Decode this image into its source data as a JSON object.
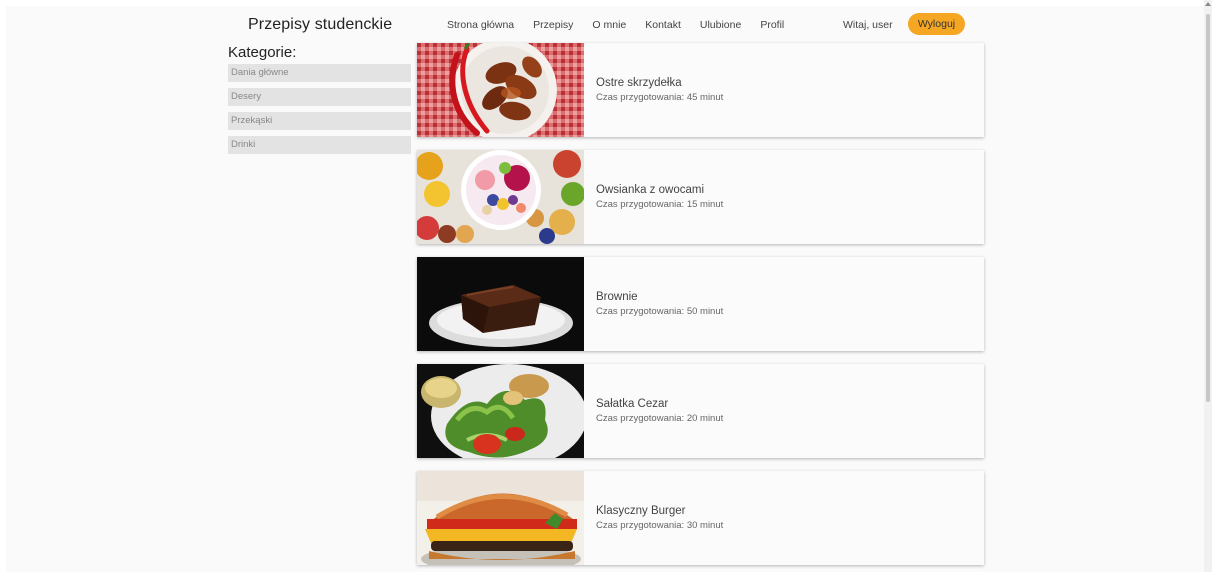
{
  "header": {
    "brand": "Przepisy studenckie",
    "nav": [
      "Strona główna",
      "Przepisy",
      "O mnie",
      "Kontakt",
      "Ulubione",
      "Profil"
    ],
    "greeting": "Witaj, user",
    "logout_label": "Wyloguj",
    "accent_color": "#f5a623"
  },
  "sidebar": {
    "title": "Kategorie:",
    "categories": [
      "Dania główne",
      "Desery",
      "Przekąski",
      "Drinki"
    ]
  },
  "recipes": [
    {
      "name": "Ostre skrzydełka",
      "time": "Czas przygotowania: 45 minut",
      "image": "chicken-wings"
    },
    {
      "name": "Owsianka z owocami",
      "time": "Czas przygotowania: 15 minut",
      "image": "fruit-bowl"
    },
    {
      "name": "Brownie",
      "time": "Czas przygotowania: 50 minut",
      "image": "brownie"
    },
    {
      "name": "Sałatka Cezar",
      "time": "Czas przygotowania: 20 minut",
      "image": "caesar-salad"
    },
    {
      "name": "Klasyczny Burger",
      "time": "Czas przygotowania: 30 minut",
      "image": "burger"
    }
  ]
}
